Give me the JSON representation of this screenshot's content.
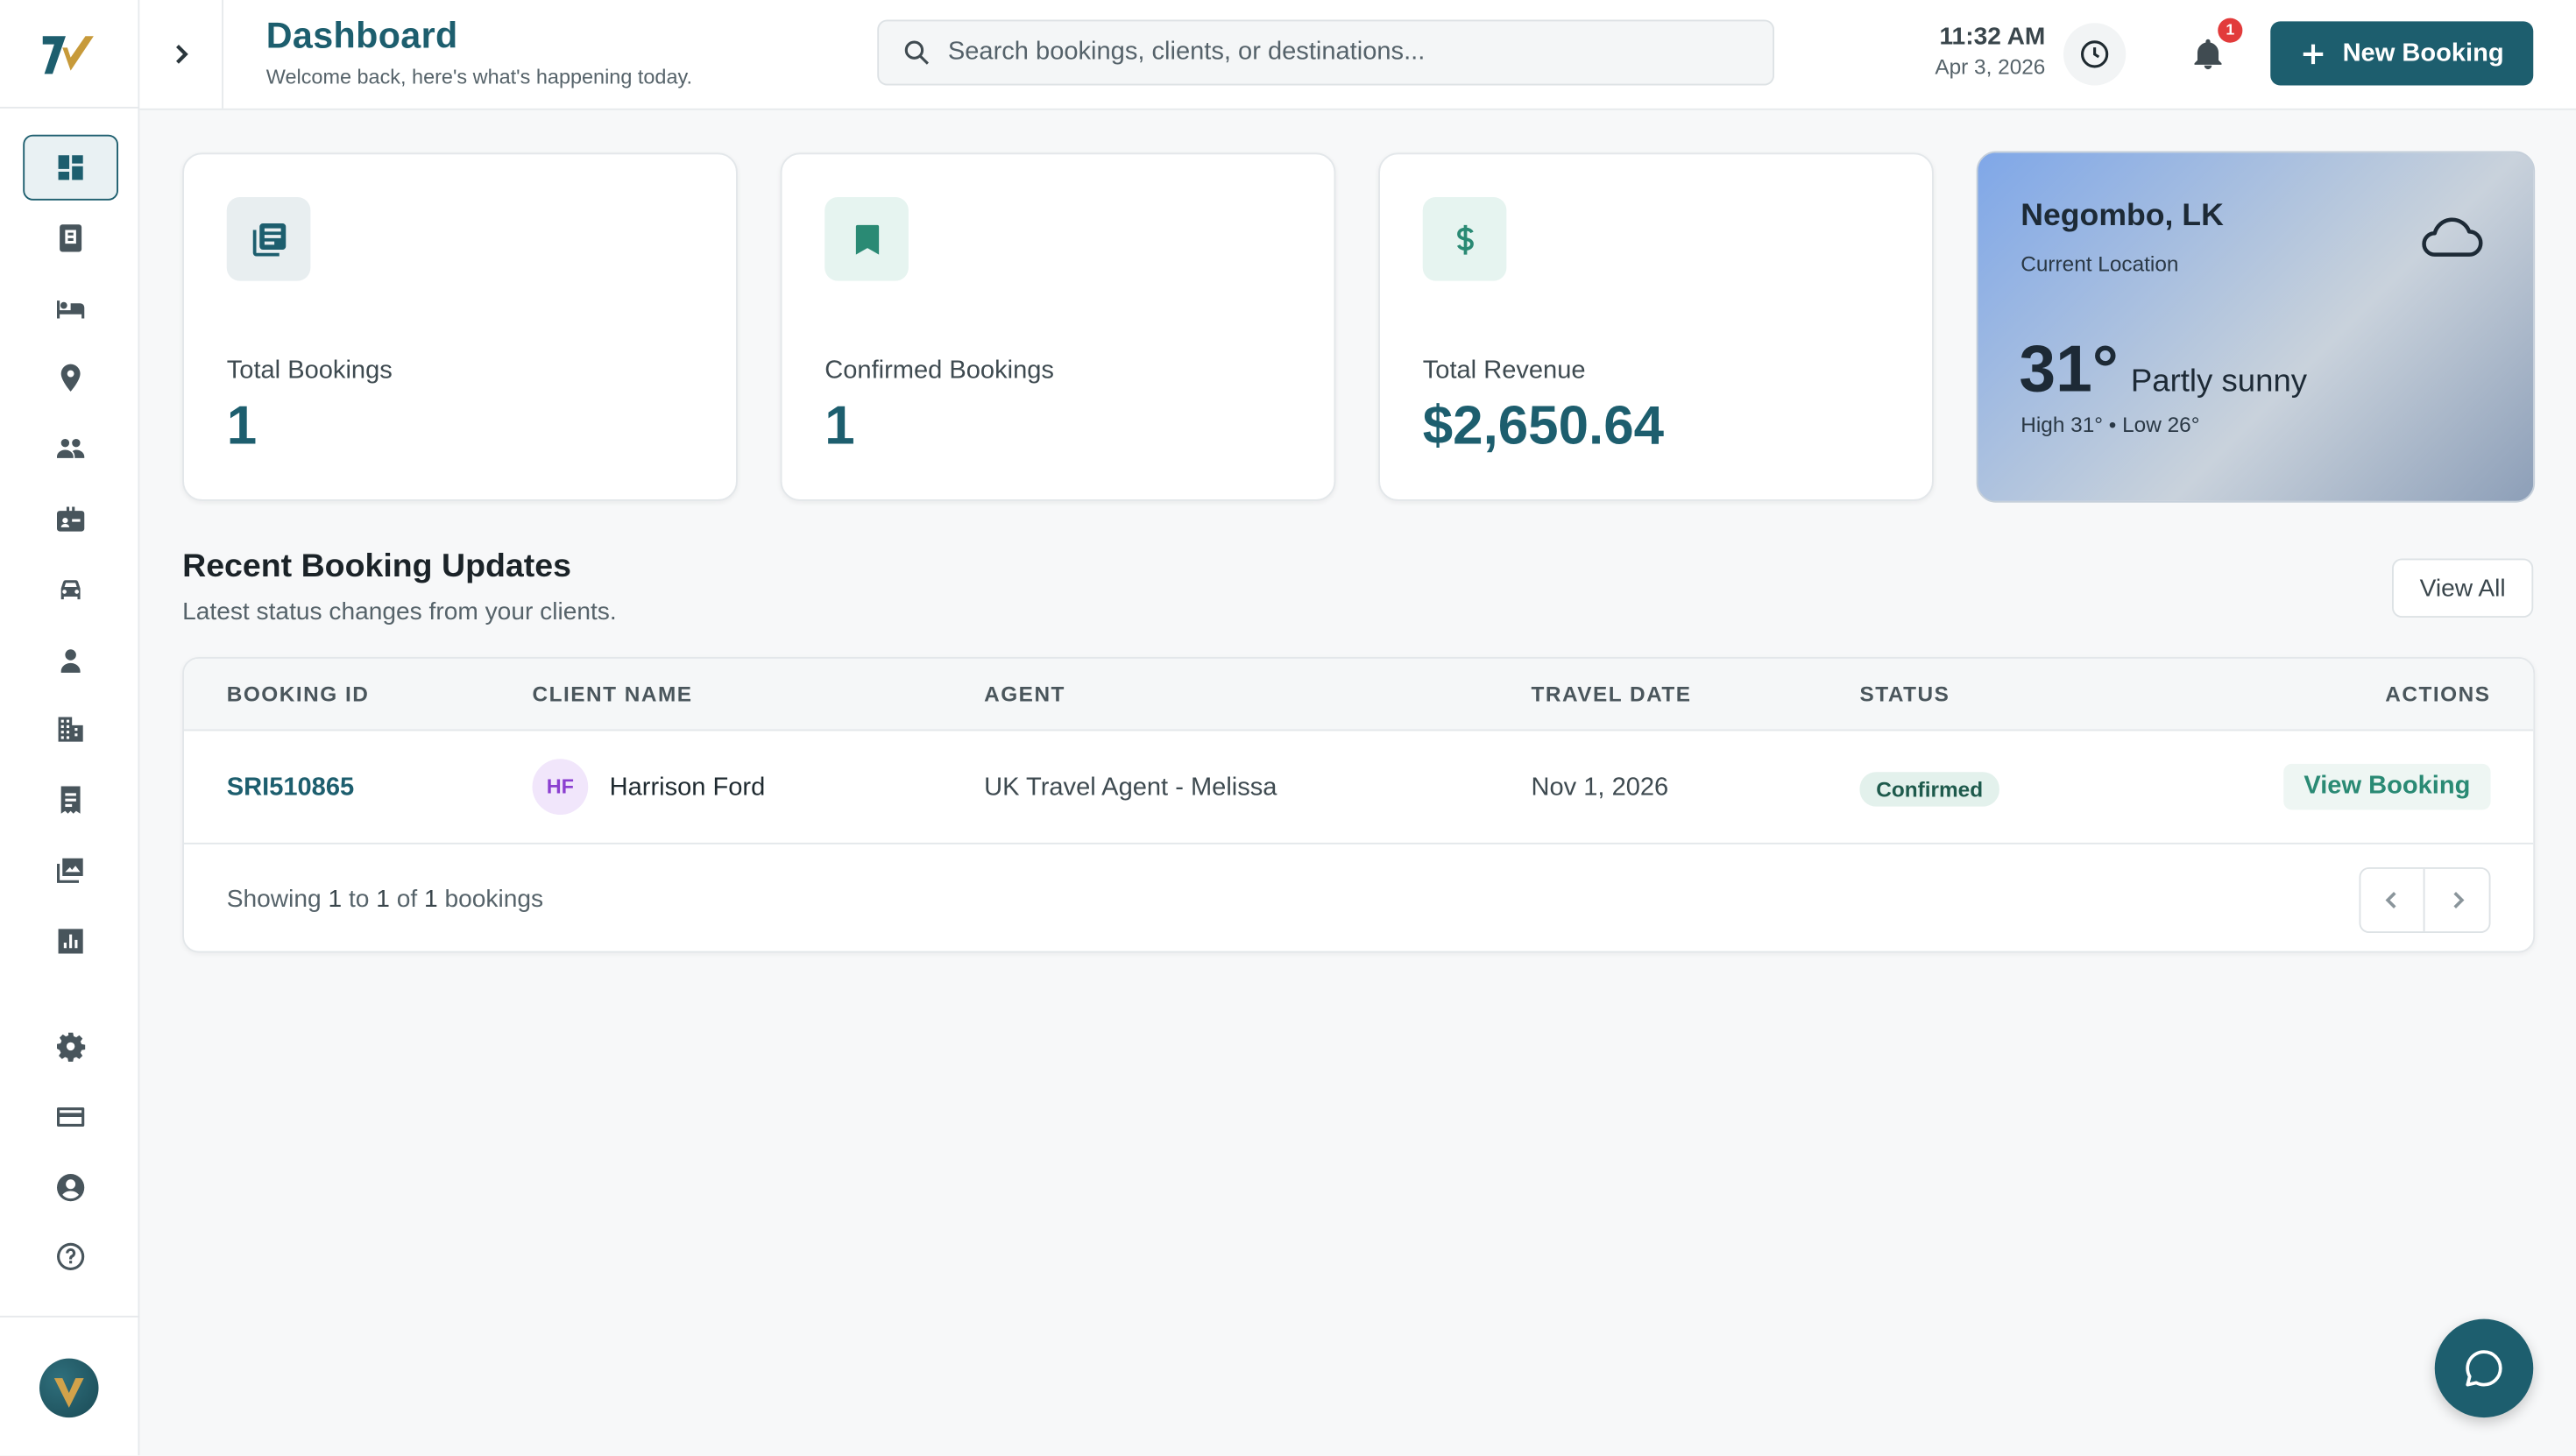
{
  "header": {
    "title": "Dashboard",
    "subtitle": "Welcome back, here's what's happening today.",
    "search_placeholder": "Search bookings, clients, or destinations...",
    "time": "11:32 AM",
    "date": "Apr 3, 2026",
    "notification_count": "1",
    "new_booking_label": "New Booking"
  },
  "sidebar": {
    "items": [
      {
        "icon": "dashboard-icon",
        "active": true
      },
      {
        "icon": "bookings-icon"
      },
      {
        "icon": "hotel-bed-icon"
      },
      {
        "icon": "location-pin-icon"
      },
      {
        "icon": "clients-group-icon"
      },
      {
        "icon": "agent-badge-icon"
      },
      {
        "icon": "car-icon"
      },
      {
        "icon": "person-icon"
      },
      {
        "icon": "buildings-icon"
      },
      {
        "icon": "invoice-icon"
      },
      {
        "icon": "gallery-icon"
      },
      {
        "icon": "reports-chart-icon"
      }
    ],
    "bottom_items": [
      {
        "icon": "settings-gear-icon"
      },
      {
        "icon": "credit-card-icon"
      },
      {
        "icon": "account-circle-icon"
      },
      {
        "icon": "help-icon"
      }
    ]
  },
  "stats": [
    {
      "label": "Total Bookings",
      "value": "1",
      "icon": "booklist-icon"
    },
    {
      "label": "Confirmed Bookings",
      "value": "1",
      "icon": "bookmark-icon"
    },
    {
      "label": "Total Revenue",
      "value": "$2,650.64",
      "icon": "dollar-icon"
    }
  ],
  "weather": {
    "city": "Negombo, LK",
    "location_label": "Current Location",
    "temperature": "31°",
    "condition": "Partly sunny",
    "high_low": "High 31° • Low 26°",
    "icon": "cloud-icon"
  },
  "recent": {
    "title": "Recent Booking Updates",
    "subtitle": "Latest status changes from your clients.",
    "view_all_label": "View All",
    "columns": [
      "BOOKING ID",
      "CLIENT NAME",
      "AGENT",
      "TRAVEL DATE",
      "STATUS",
      "ACTIONS"
    ],
    "rows": [
      {
        "booking_id": "SRI510865",
        "client_initials": "HF",
        "client_name": "Harrison Ford",
        "agent": "UK Travel Agent - Melissa",
        "travel_date": "Nov 1, 2026",
        "status": "Confirmed",
        "action_label": "View Booking"
      }
    ],
    "footer": {
      "prefix": "Showing",
      "from": "1",
      "to_word": "to",
      "to": "1",
      "of_word": "of",
      "total": "1",
      "suffix": "bookings"
    }
  },
  "colors": {
    "brand": "#1d5e6e",
    "confirmed_bg": "#e3f1ec",
    "confirmed_text": "#1e5a4c",
    "badge": "#e23b3b"
  }
}
